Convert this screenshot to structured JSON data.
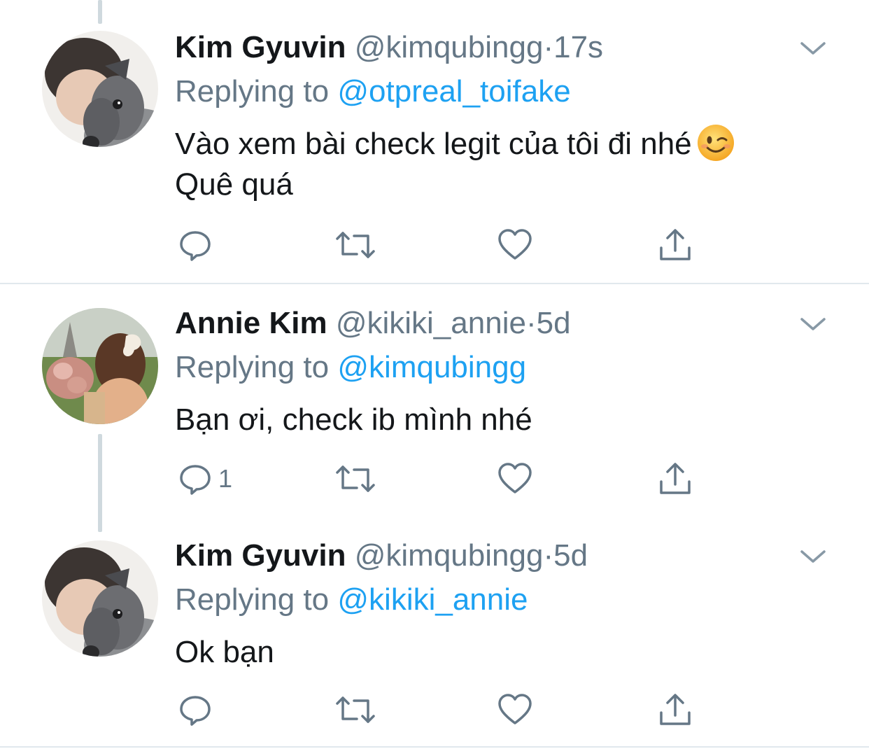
{
  "tweets": [
    {
      "name": "Kim Gyuvin",
      "handle": "@kimqubingg",
      "separator": "·",
      "time": "17s",
      "replying_prefix": "Replying to",
      "replying_to": "@otpreal_toifake",
      "text_line1": "Vào xem bài check legit của tôi đi nhé",
      "text_line2": "Quê quá",
      "emoji": "winking-face",
      "reply_count": "",
      "avatar": "dog-and-person"
    },
    {
      "name": "Annie Kim",
      "handle": "@kikiki_annie",
      "separator": "·",
      "time": "5d",
      "replying_prefix": "Replying to",
      "replying_to": "@kimqubingg",
      "text_line1": "Bạn ơi, check ib mình nhé",
      "reply_count": "1",
      "avatar": "woman-with-flowers"
    },
    {
      "name": "Kim Gyuvin",
      "handle": "@kimqubingg",
      "separator": "·",
      "time": "5d",
      "replying_prefix": "Replying to",
      "replying_to": "@kikiki_annie",
      "text_line1": "Ok bạn",
      "reply_count": "",
      "avatar": "dog-and-person"
    }
  ],
  "icons": {
    "reply": "reply-icon",
    "retweet": "retweet-icon",
    "like": "heart-icon",
    "share": "share-icon",
    "more": "chevron-down-icon"
  },
  "colors": {
    "text": "#14171a",
    "secondary": "#657786",
    "accent": "#1da1f2",
    "divider": "#e1e8ed",
    "thread_line": "#cfd9de"
  }
}
